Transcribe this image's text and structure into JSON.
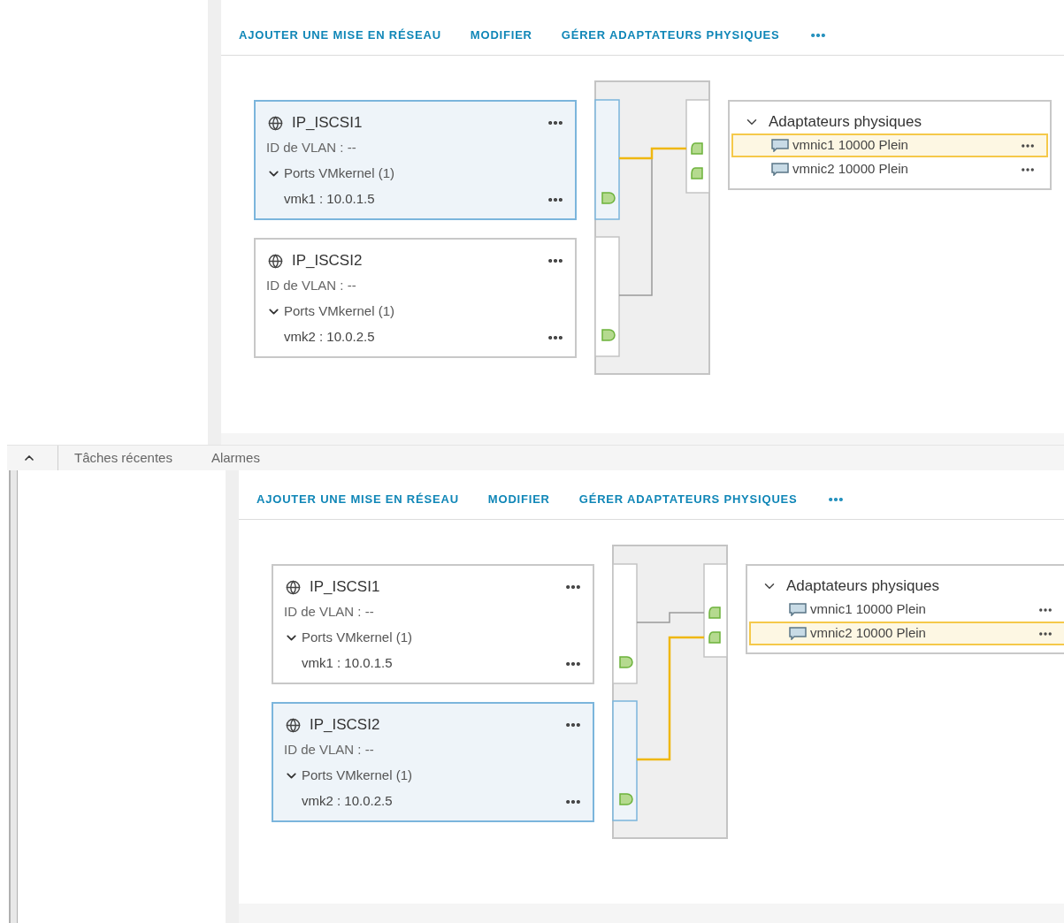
{
  "panels": [
    {
      "toolbar": [
        "AJOUTER UNE MISE EN RÉSEAU",
        "MODIFIER",
        "GÉRER ADAPTATEURS PHYSIQUES"
      ],
      "port_groups": [
        {
          "name": "IP_ISCSI1",
          "vlan": "ID de VLAN : --",
          "ports_label": "Ports VMkernel (1)",
          "expanded": true,
          "vmk": "vmk1 : 10.0.1.5",
          "selected": true
        },
        {
          "name": "IP_ISCSI2",
          "vlan": "ID de VLAN : --",
          "ports_label": "Ports VMkernel (1)",
          "expanded": true,
          "vmk": "vmk2 : 10.0.2.5",
          "selected": false
        }
      ],
      "adapters": {
        "title": "Adaptateurs physiques",
        "expanded": true,
        "items": [
          {
            "label": "vmnic1 10000 Plein",
            "selected": true
          },
          {
            "label": "vmnic2 10000 Plein",
            "selected": false
          }
        ]
      },
      "bottom_tabs": [
        "Tâches récentes",
        "Alarmes"
      ]
    },
    {
      "toolbar": [
        "AJOUTER UNE MISE EN RÉSEAU",
        "MODIFIER",
        "GÉRER ADAPTATEURS PHYSIQUES"
      ],
      "port_groups": [
        {
          "name": "IP_ISCSI1",
          "vlan": "ID de VLAN : --",
          "ports_label": "Ports VMkernel (1)",
          "expanded": true,
          "vmk": "vmk1 : 10.0.1.5",
          "selected": false
        },
        {
          "name": "IP_ISCSI2",
          "vlan": "ID de VLAN : --",
          "ports_label": "Ports VMkernel (1)",
          "expanded": true,
          "vmk": "vmk2 : 10.0.2.5",
          "selected": true
        }
      ],
      "adapters": {
        "title": "Adaptateurs physiques",
        "expanded": true,
        "items": [
          {
            "label": "vmnic1 10000 Plein",
            "selected": false
          },
          {
            "label": "vmnic2 10000 Plein",
            "selected": true
          }
        ]
      }
    }
  ]
}
